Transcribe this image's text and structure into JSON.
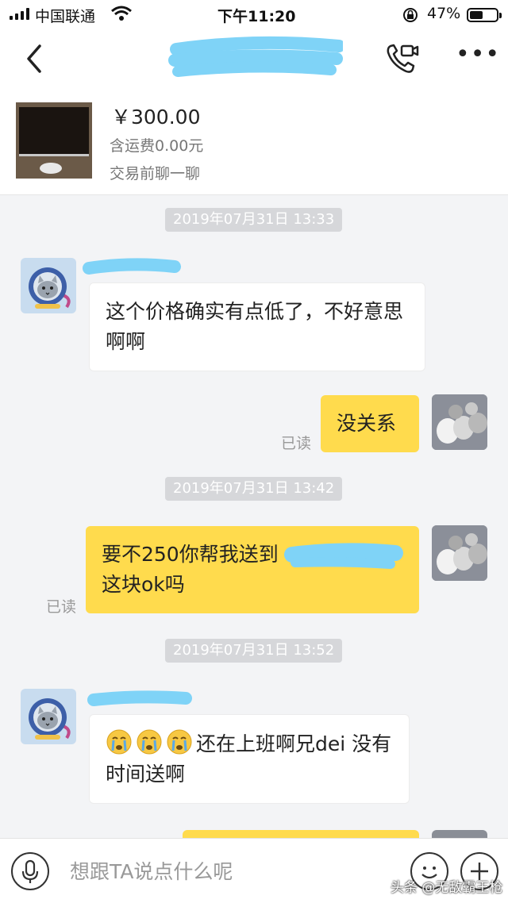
{
  "status_bar": {
    "carrier": "中国联通",
    "time": "下午11:20",
    "battery_percent": "47%"
  },
  "product": {
    "price": "￥300.00",
    "shipping": "含运费0.00元",
    "chat_prompt": "交易前聊一聊"
  },
  "messages": {
    "ts1": "2019年07月31日 13:33",
    "m1": "这个价格确实有点低了，不好意思啊啊",
    "m2": "没关系",
    "ts2": "2019年07月31日 13:42",
    "m3": "要不250你帮我送到",
    "m3_tail": "这块ok吗",
    "ts3": "2019年07月31日 13:52",
    "m4": "还在上班啊兄dei  没有时间送啊",
    "read_label": "已读"
  },
  "input": {
    "placeholder": "想跟TA说点什么呢"
  },
  "watermark": "头条 @无敌霸王枪",
  "colors": {
    "outgoing_bubble": "#ffdb4d",
    "incoming_bubble": "#ffffff",
    "blur_marker": "#7fd3f7"
  }
}
